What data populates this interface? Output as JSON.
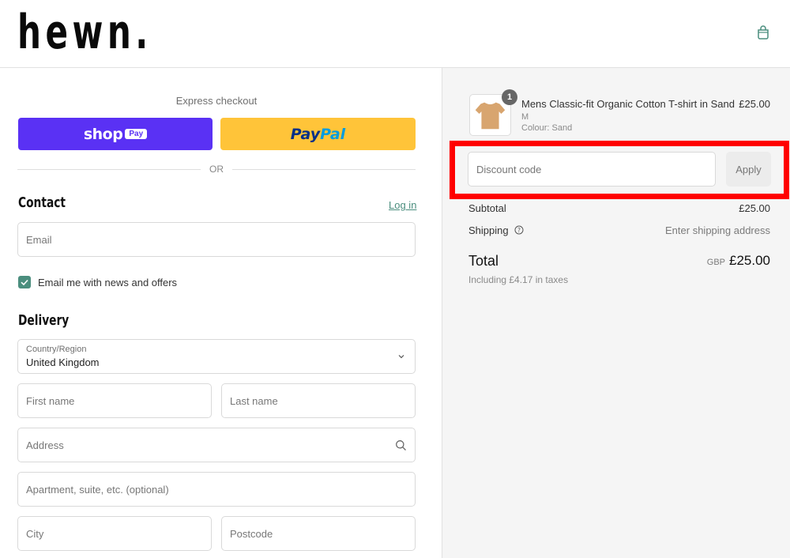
{
  "header": {
    "logo": "hewn.",
    "cart_icon": "shopping-bag-icon"
  },
  "express": {
    "label": "Express checkout",
    "shop_pay": {
      "text": "shop",
      "badge": "Pay"
    },
    "paypal": {
      "part1": "Pay",
      "part2": "Pal"
    },
    "divider": "OR"
  },
  "contact": {
    "title": "Contact",
    "login": "Log in",
    "email_placeholder": "Email",
    "newsletter_label": "Email me with news and offers",
    "newsletter_checked": true
  },
  "delivery": {
    "title": "Delivery",
    "country_label": "Country/Region",
    "country_value": "United Kingdom",
    "first_name_placeholder": "First name",
    "last_name_placeholder": "Last name",
    "address_placeholder": "Address",
    "apartment_placeholder": "Apartment, suite, etc. (optional)",
    "city_placeholder": "City",
    "postcode_placeholder": "Postcode"
  },
  "summary": {
    "item": {
      "quantity": "1",
      "name": "Mens Classic-fit Organic Cotton T-shirt in Sand",
      "size": "M",
      "colour": "Colour: Sand",
      "price": "£25.00"
    },
    "discount_placeholder": "Discount code",
    "apply": "Apply",
    "subtotal_label": "Subtotal",
    "subtotal_value": "£25.00",
    "shipping_label": "Shipping",
    "shipping_value": "Enter shipping address",
    "total_label": "Total",
    "total_currency": "GBP",
    "total_value": "£25.00",
    "tax_note": "Including £4.17 in taxes"
  },
  "colors": {
    "accent": "#4b8e7e",
    "shop_pay": "#5a31f4",
    "paypal": "#ffc439",
    "highlight": "#ff0000"
  }
}
